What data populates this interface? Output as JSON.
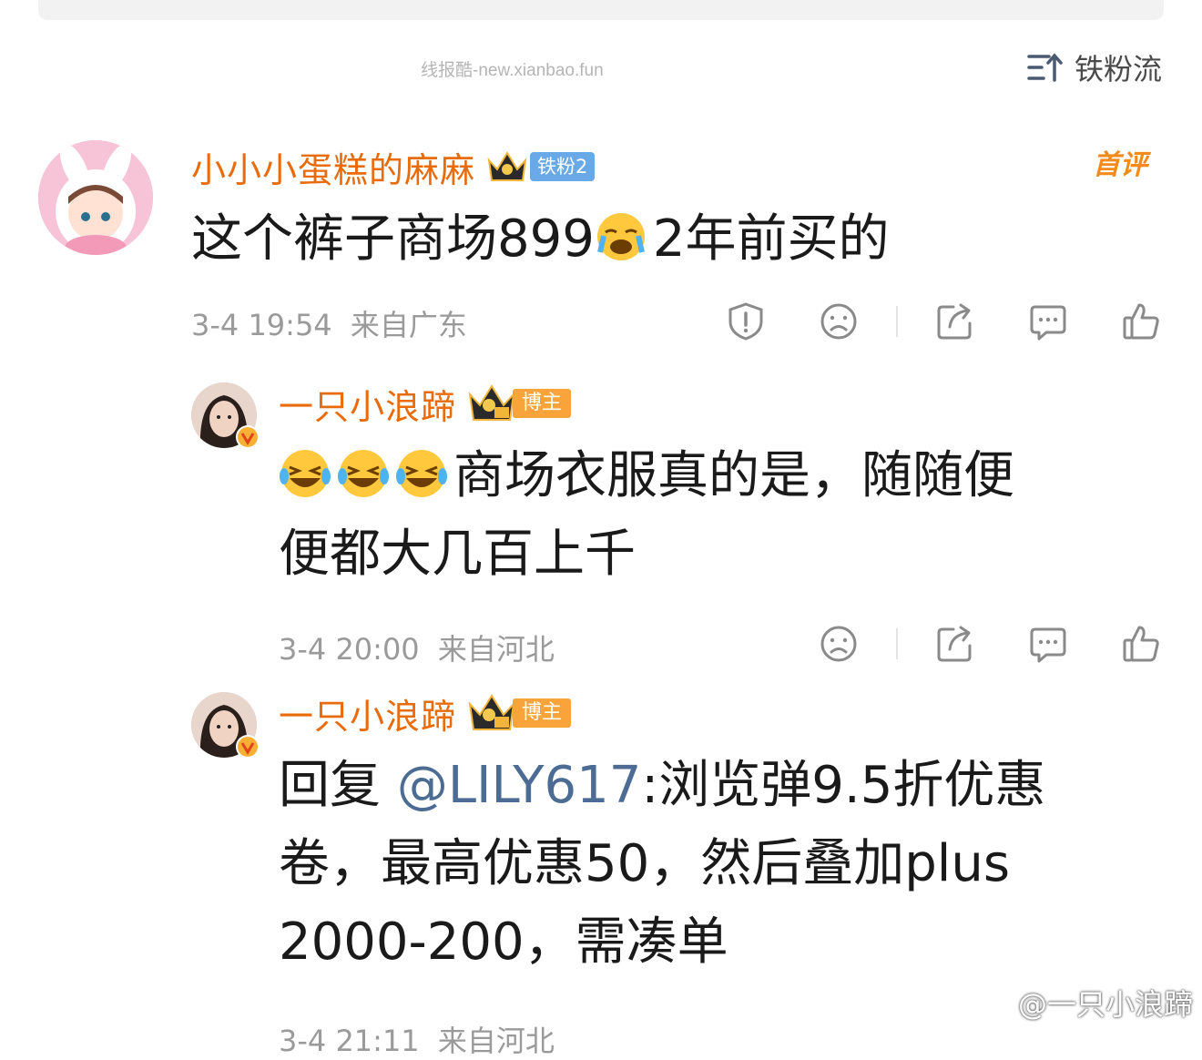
{
  "watermark_text": "线报酷-new.xianbao.fun",
  "sort_label": "铁粉流",
  "comments": [
    {
      "name": "小小小蛋糕的麻麻",
      "badge": "铁粉2",
      "first_comment_label": "首评",
      "text": "这个裤子商场899😭2年前买的",
      "text_before_emoji": "这个裤子商场899",
      "text_after_emoji": "2年前买的",
      "time": "3-4 19:54",
      "location": "来自广东"
    },
    {
      "name": "一只小浪蹄",
      "badge": "博主",
      "text_line1": "商场衣服真的是，随随便",
      "text_line2": "便都大几百上千",
      "time": "3-4 20:00",
      "location": "来自河北"
    },
    {
      "name": "一只小浪蹄",
      "badge": "博主",
      "reply_prefix": "回复",
      "mention": "@LILY617",
      "text_line1": ":浏览弹9.5折优惠",
      "text_line2": "卷，最高优惠50，然后叠加plus",
      "text_line3": "2000-200，需凑单",
      "time": "3-4 21:11",
      "location": "来自河北"
    }
  ],
  "weibo_watermark": "@一只小浪蹄",
  "colors": {
    "name": "#e86b0c",
    "mention": "#4d6c94",
    "meta": "#9a9a9a",
    "fan_badge": "#6aa9e8",
    "host_badge": "#f8a43a"
  }
}
